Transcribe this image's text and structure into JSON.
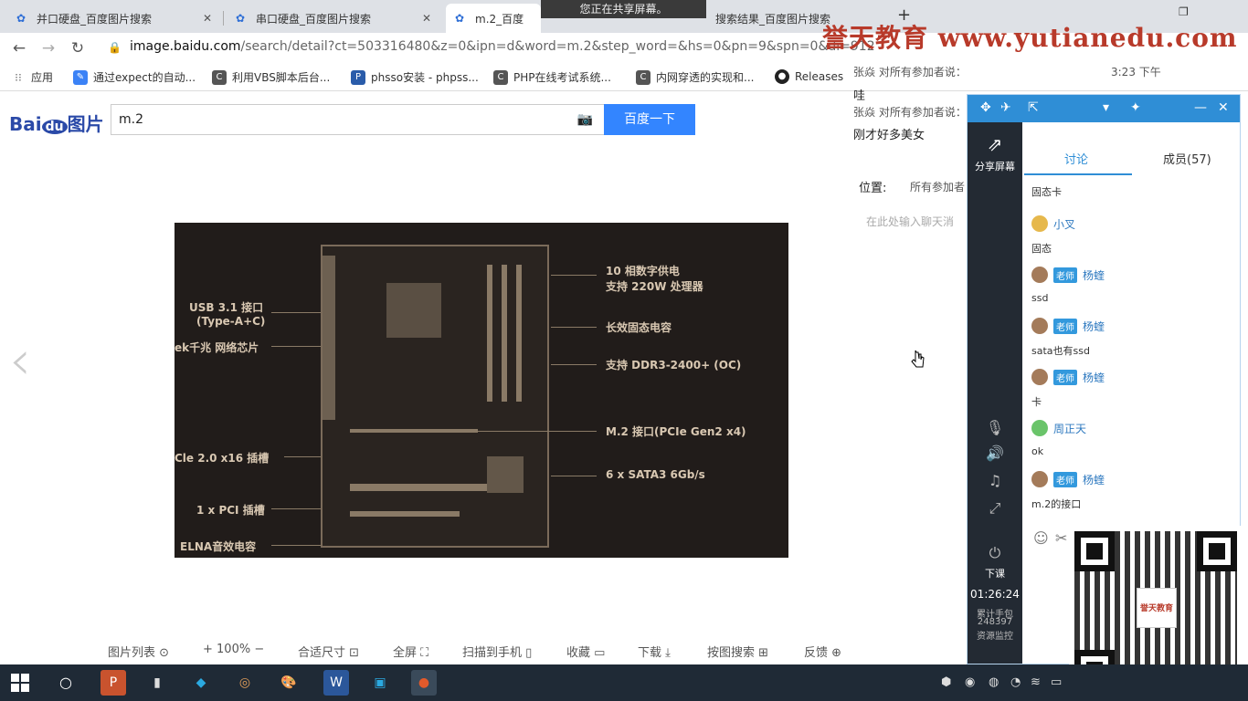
{
  "tabs": [
    {
      "label": "并口硬盘_百度图片搜索",
      "active": false
    },
    {
      "label": "串口硬盘_百度图片搜索",
      "active": false
    },
    {
      "label": "m.2_百度",
      "active": true
    },
    {
      "label": "搜索结果_百度图片搜索",
      "active": false
    }
  ],
  "new_tab_glyph": "+",
  "share_banner": "您正在共享屏幕。",
  "address": {
    "host": "image.baidu.com",
    "rest": "/search/detail?ct=503316480&z=0&ipn=d&word=m.2&step_word=&hs=0&pn=9&spn=0&di=912"
  },
  "bookmarks": [
    {
      "label": "应用"
    },
    {
      "label": "通过expect的自动..."
    },
    {
      "label": "利用VBS脚本后台..."
    },
    {
      "label": "phsso安装 - phpss..."
    },
    {
      "label": "PHP在线考试系统..."
    },
    {
      "label": "内网穿透的实现和..."
    },
    {
      "label": "Releases"
    }
  ],
  "baidu": {
    "logo_text": "Bai",
    "logo_du": "du",
    "logo_suffix": "图片",
    "query": "m.2",
    "search_button": "百度一下"
  },
  "motherboard": {
    "labels_right": [
      "10 相数字供电",
      "支持 220W 处理器",
      "长效固态电容",
      "支持 DDR3-2400+ (OC)",
      "M.2 接口(PCIe Gen2 x4)",
      "6 x SATA3 6Gb/s"
    ],
    "labels_left": [
      "USB 3.1 接口",
      "(Type-A+C)",
      "ek千兆 网络芯片",
      "Cle 2.0 x16 插槽",
      "1 x PCI 插槽",
      "ELNA音效电容"
    ]
  },
  "image_toolbar": [
    {
      "label": "图片列表 ⊙"
    },
    {
      "label": "+ 100% −"
    },
    {
      "label": "合适尺寸 ⊡"
    },
    {
      "label": "全屏 ⛶"
    },
    {
      "label": "扫描到手机 ▯"
    },
    {
      "label": "收藏 ▭"
    },
    {
      "label": "下载 ⤓"
    },
    {
      "label": "按图搜索 ⊞"
    },
    {
      "label": "反馈 ⊕"
    }
  ],
  "watermark": "誉天教育 www.yutianedu.com",
  "chat_overlay": {
    "line1_sender": "张焱 对所有参加者说：",
    "line1_time": "3:23 下午",
    "line1_msg": "哇",
    "line2_sender": "张焱 对所有参加者说：",
    "line2_msg": "刚才好多美女",
    "position_label": "位置:",
    "position_value": "所有参加者",
    "input_placeholder": "在此处输入聊天消"
  },
  "meeting": {
    "share_screen": "分享屏幕",
    "tab_discussion": "讨论",
    "tab_members": "成员(57)",
    "end_class": "下课",
    "timer": "01:26:24",
    "stats_line1": "累计手包",
    "stats_line2": "248397",
    "stats_line3": "资源监控",
    "messages": [
      {
        "badge": "老师",
        "name": "杨蝰",
        "text": "固态卡"
      },
      {
        "badge": "",
        "name": "小叉",
        "text": "固态"
      },
      {
        "badge": "老师",
        "name": "杨蝰",
        "text": "ssd"
      },
      {
        "badge": "老师",
        "name": "杨蝰",
        "text": "sata也有ssd"
      },
      {
        "badge": "老师",
        "name": "杨蝰",
        "text": "卡"
      },
      {
        "badge": "",
        "name": "周正天",
        "text": "ok"
      },
      {
        "badge": "老师",
        "name": "杨蝰",
        "text": "m.2的接口"
      }
    ]
  },
  "qr_logo_text": "誉天教育",
  "taskbar": {
    "apps": [
      "P",
      "▮",
      "◆",
      "◎",
      "🎨",
      "W",
      "▣",
      "●"
    ]
  }
}
